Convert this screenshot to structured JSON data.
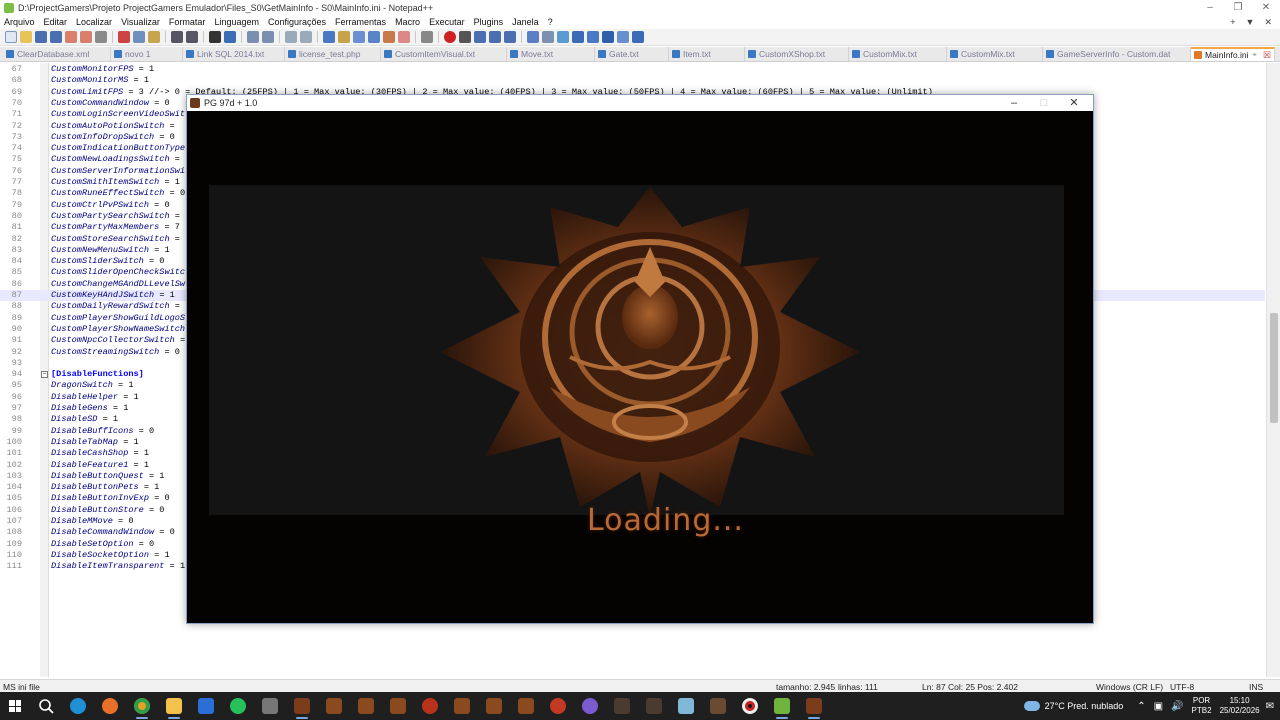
{
  "notepad": {
    "title": "D:\\ProjectGamers\\Projeto ProjectGamers Emulador\\Files_S0\\GetMainInfo - S0\\MainInfo.ini - Notepad++",
    "menu": [
      "Arquivo",
      "Editar",
      "Localizar",
      "Visualizar",
      "Formatar",
      "Linguagem",
      "Configurações",
      "Ferramentas",
      "Macro",
      "Executar",
      "Plugins",
      "Janela",
      "?"
    ],
    "tabs": [
      {
        "label": "ClearDatabase.xml",
        "active": false
      },
      {
        "label": "novo 1",
        "active": false
      },
      {
        "label": "Link SQL 2014.txt",
        "active": false
      },
      {
        "label": "license_test.php",
        "active": false
      },
      {
        "label": "CustomItemVisual.txt",
        "active": false
      },
      {
        "label": "Move.txt",
        "active": false
      },
      {
        "label": "Gate.txt",
        "active": false
      },
      {
        "label": "Item.txt",
        "active": false
      },
      {
        "label": "CustomXShop.txt",
        "active": false
      },
      {
        "label": "CustomMix.txt",
        "active": false
      },
      {
        "label": "CustomMix.txt",
        "active": false
      },
      {
        "label": "GameServerInfo - Custom.dat",
        "active": false
      },
      {
        "label": "MainInfo.ini",
        "active": true
      }
    ],
    "lines": [
      {
        "n": "67",
        "key": "CustomMonitorFPS",
        "rest": " = 1"
      },
      {
        "n": "68",
        "key": "CustomMonitorMS",
        "rest": " = 1"
      },
      {
        "n": "69",
        "key": "CustomLimitFPS",
        "rest": " = 3 //-> 0 = Default: (25FPS) | 1 = Max value: (30FPS) | 2 = Max value: (40FPS) | 3 = Max value: (50FPS) | 4 = Max value: (60FPS) | 5 = Max value: (Unlimit)"
      },
      {
        "n": "70",
        "key": "CustomCommandWindow",
        "rest": " = 0"
      },
      {
        "n": "71",
        "key": "CustomLoginScreenVideoSwit",
        "rest": ""
      },
      {
        "n": "72",
        "key": "CustomAutoPotionSwitch",
        "rest": " ="
      },
      {
        "n": "73",
        "key": "CustomInfoDropSwitch",
        "rest": " = 0"
      },
      {
        "n": "74",
        "key": "CustomIndicationButtonType",
        "rest": ""
      },
      {
        "n": "75",
        "key": "CustomNewLoadingsSwitch",
        "rest": " ="
      },
      {
        "n": "76",
        "key": "CustomServerInformationSwi",
        "rest": ""
      },
      {
        "n": "77",
        "key": "CustomSmithItemSwitch",
        "rest": " = 1"
      },
      {
        "n": "78",
        "key": "CustomRuneEffectSwitch",
        "rest": " = 0"
      },
      {
        "n": "79",
        "key": "CustomCtrlPvPSwitch",
        "rest": " = 0"
      },
      {
        "n": "80",
        "key": "CustomPartySearchSwitch",
        "rest": " ="
      },
      {
        "n": "81",
        "key": "CustomPartyMaxMembers",
        "rest": " = 7"
      },
      {
        "n": "82",
        "key": "CustomStoreSearchSwitch",
        "rest": " ="
      },
      {
        "n": "83",
        "key": "CustomNewMenuSwitch",
        "rest": " = 1"
      },
      {
        "n": "84",
        "key": "CustomSliderSwitch",
        "rest": " = 0"
      },
      {
        "n": "85",
        "key": "CustomSliderOpenCheckSwitc",
        "rest": ""
      },
      {
        "n": "86",
        "key": "CustomChangeMGAndDLLevelSw",
        "rest": ""
      },
      {
        "n": "87",
        "key": "CustomKeyHAndJSwitch",
        "rest": " = 1"
      },
      {
        "n": "88",
        "key": "CustomDailyRewardSwitch",
        "rest": " ="
      },
      {
        "n": "89",
        "key": "CustomPlayerShowGuildLogoS",
        "rest": ""
      },
      {
        "n": "90",
        "key": "CustomPlayerShowNameSwitch",
        "rest": ""
      },
      {
        "n": "91",
        "key": "CustomNpcCollectorSwitch",
        "rest": " ="
      },
      {
        "n": "92",
        "key": "CustomStreamingSwitch",
        "rest": " = 0"
      },
      {
        "n": "93",
        "key": "",
        "rest": ""
      },
      {
        "n": "94",
        "key": "[DisableFunctions]",
        "rest": ""
      },
      {
        "n": "95",
        "key": "DragonSwitch",
        "rest": " = 1"
      },
      {
        "n": "96",
        "key": "DisableHelper",
        "rest": " = 1"
      },
      {
        "n": "97",
        "key": "DisableGens",
        "rest": " = 1"
      },
      {
        "n": "98",
        "key": "DisableSD",
        "rest": " = 1"
      },
      {
        "n": "99",
        "key": "DisableBuffIcons",
        "rest": " = 0"
      },
      {
        "n": "100",
        "key": "DisableTabMap",
        "rest": " = 1"
      },
      {
        "n": "101",
        "key": "DisableCashShop",
        "rest": " = 1"
      },
      {
        "n": "102",
        "key": "DisableFeature1",
        "rest": " = 1"
      },
      {
        "n": "103",
        "key": "DisableButtonQuest",
        "rest": " = 1"
      },
      {
        "n": "104",
        "key": "DisableButtonPets",
        "rest": " = 1"
      },
      {
        "n": "105",
        "key": "DisableButtonInvExp",
        "rest": " = 0"
      },
      {
        "n": "106",
        "key": "DisableButtonStore",
        "rest": " = 0"
      },
      {
        "n": "107",
        "key": "DisableMMove",
        "rest": " = 0"
      },
      {
        "n": "108",
        "key": "DisableCommandWindow",
        "rest": " = 0"
      },
      {
        "n": "109",
        "key": "DisableSetOption",
        "rest": " = 0"
      },
      {
        "n": "110",
        "key": "DisableSocketOption",
        "rest": " = 1"
      },
      {
        "n": "111",
        "key": "DisableItemTransparent",
        "rest": " = 1"
      }
    ],
    "status": {
      "filetype": "MS ini file",
      "size": "tamanho: 2.945",
      "lines": "linhas: 111",
      "position": "Ln: 87   Col: 25   Pos: 2.402",
      "eol": "Windows (CR LF)",
      "encoding": "UTF-8",
      "mode": "INS"
    }
  },
  "game": {
    "title": "PG 97d + 1.0",
    "loading_text": "Loading..."
  },
  "taskbar": {
    "weather_temp": "27°C",
    "weather_desc": "Pred. nublado",
    "lang_top": "POR",
    "lang_bottom": "PTB2",
    "time": "15:10",
    "date": "25/02/2026"
  }
}
